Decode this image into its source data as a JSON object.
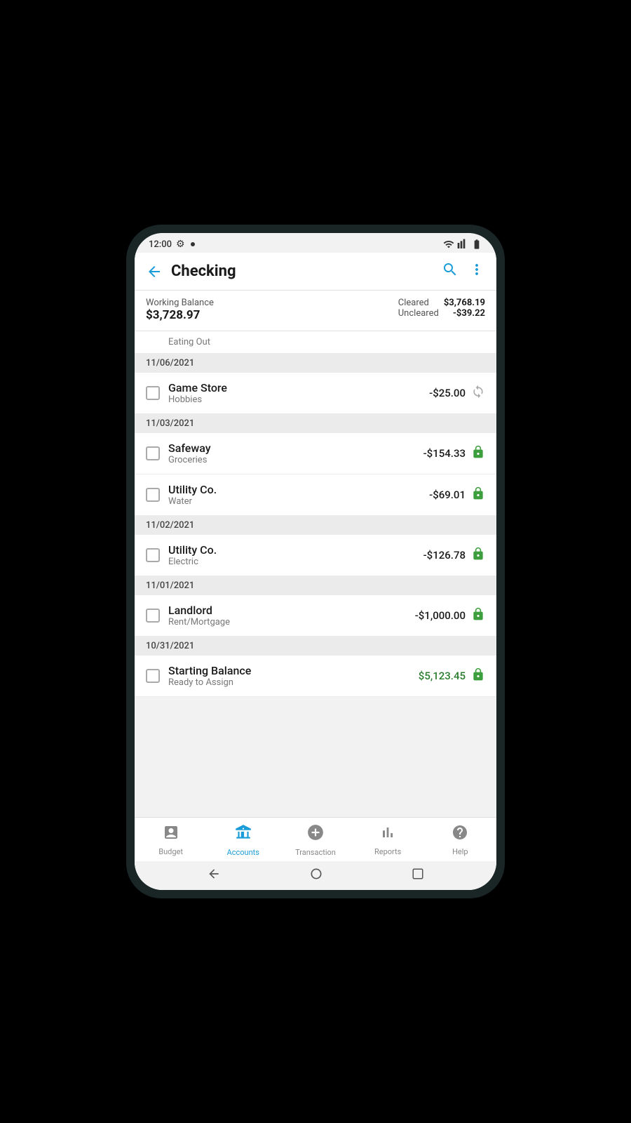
{
  "statusBar": {
    "time": "12:00"
  },
  "header": {
    "title": "Checking",
    "backLabel": "←",
    "searchLabel": "🔍",
    "moreLabel": "⋮"
  },
  "balance": {
    "workingBalanceLabel": "Working Balance",
    "workingBalanceAmount": "$3,728.97",
    "clearedLabel": "Cleared",
    "clearedAmount": "$3,768.19",
    "unclearedLabel": "Uncleared",
    "unclearedAmount": "-$39.22"
  },
  "partialRow": {
    "category": "Eating Out"
  },
  "transactions": [
    {
      "dateHeader": "11/06/2021",
      "items": [
        {
          "name": "Game Store",
          "category": "Hobbies",
          "amount": "-$25.00",
          "icon": "sync",
          "positive": false
        }
      ]
    },
    {
      "dateHeader": "11/03/2021",
      "items": [
        {
          "name": "Safeway",
          "category": "Groceries",
          "amount": "-$154.33",
          "icon": "lock",
          "positive": false
        },
        {
          "name": "Utility Co.",
          "category": "Water",
          "amount": "-$69.01",
          "icon": "lock",
          "positive": false
        }
      ]
    },
    {
      "dateHeader": "11/02/2021",
      "items": [
        {
          "name": "Utility Co.",
          "category": "Electric",
          "amount": "-$126.78",
          "icon": "lock",
          "positive": false
        }
      ]
    },
    {
      "dateHeader": "11/01/2021",
      "items": [
        {
          "name": "Landlord",
          "category": "Rent/Mortgage",
          "amount": "-$1,000.00",
          "icon": "lock",
          "positive": false
        }
      ]
    },
    {
      "dateHeader": "10/31/2021",
      "items": [
        {
          "name": "Starting Balance",
          "category": "Ready to Assign",
          "amount": "$5,123.45",
          "icon": "lock",
          "positive": true
        }
      ]
    }
  ],
  "bottomNav": {
    "items": [
      {
        "id": "budget",
        "label": "Budget",
        "icon": "🗃",
        "active": false
      },
      {
        "id": "accounts",
        "label": "Accounts",
        "icon": "🏛",
        "active": true
      },
      {
        "id": "transaction",
        "label": "Transaction",
        "icon": "➕",
        "active": false
      },
      {
        "id": "reports",
        "label": "Reports",
        "icon": "📊",
        "active": false
      },
      {
        "id": "help",
        "label": "Help",
        "icon": "❓",
        "active": false
      }
    ]
  }
}
